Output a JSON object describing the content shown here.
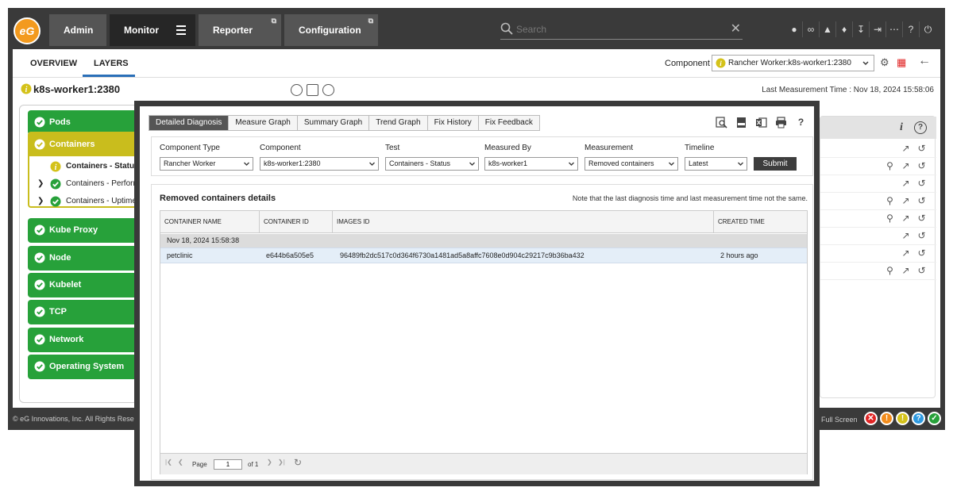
{
  "app": {
    "logo_text": "eG",
    "nav": {
      "admin": "Admin",
      "monitor": "Monitor",
      "reporter": "Reporter",
      "configuration": "Configuration",
      "external_glyph": "⧉"
    },
    "search": {
      "placeholder": "Search",
      "clear": "✕"
    },
    "toolbar_icons": [
      "user-icon",
      "link-icon",
      "alert-map-icon",
      "bell-icon",
      "download-icon",
      "login-icon",
      "more-icon",
      "help-icon",
      "power-icon"
    ]
  },
  "workspace": {
    "tabs": {
      "overview": "OVERVIEW",
      "layers": "LAYERS"
    },
    "component_label": "Component",
    "component_value": "Rancher Worker:k8s-worker1:2380",
    "page_title": "k8s-worker1:2380",
    "last_measurement": "Last Measurement Time : Nov 18, 2024 15:58:06",
    "layers": [
      {
        "label": "Pods",
        "status": "ok"
      },
      {
        "label": "Containers",
        "status": "warning"
      },
      {
        "label": "Kube Proxy",
        "status": "ok"
      },
      {
        "label": "Node",
        "status": "ok"
      },
      {
        "label": "Kubelet",
        "status": "ok"
      },
      {
        "label": "TCP",
        "status": "ok"
      },
      {
        "label": "Network",
        "status": "ok"
      },
      {
        "label": "Operating System",
        "status": "ok"
      }
    ],
    "container_tests": [
      {
        "label": "Containers - Status",
        "status": "warning"
      },
      {
        "label": "Containers - Performance",
        "status": "ok"
      },
      {
        "label": "Containers - Uptime",
        "status": "ok"
      }
    ],
    "right_header": {
      "info": "i",
      "help": "?"
    }
  },
  "footer": {
    "copyright": "© eG Innovations, Inc. All Rights Reserved",
    "fullscreen": "Full Screen",
    "status_dots": [
      {
        "glyph": "✕",
        "color": "#e02424"
      },
      {
        "glyph": "!",
        "color": "#f28c1c"
      },
      {
        "glyph": "!",
        "color": "#d4c21a"
      },
      {
        "glyph": "?",
        "color": "#2f9ae0"
      },
      {
        "glyph": "✓",
        "color": "#27a13a"
      }
    ]
  },
  "modal": {
    "tabs": [
      "Detailed Diagnosis",
      "Measure Graph",
      "Summary Graph",
      "Trend Graph",
      "Fix History",
      "Fix Feedback"
    ],
    "active_tab": "Detailed Diagnosis",
    "tool_icons": [
      "zoom-icon",
      "pdf-icon",
      "excel-icon",
      "print-icon",
      "help-icon"
    ],
    "help_glyph": "?",
    "filters": {
      "component_type": {
        "label": "Component Type",
        "value": "Rancher Worker"
      },
      "component": {
        "label": "Component",
        "value": "k8s-worker1:2380"
      },
      "test": {
        "label": "Test",
        "value": "Containers - Status"
      },
      "measured_by": {
        "label": "Measured By",
        "value": "k8s-worker1"
      },
      "measurement": {
        "label": "Measurement",
        "value": "Removed containers"
      },
      "timeline": {
        "label": "Timeline",
        "value": "Latest"
      }
    },
    "submit_label": "Submit",
    "results_title": "Removed containers details",
    "results_note": "Note that the last diagnosis time and last measurement time not the same.",
    "columns": [
      "CONTAINER NAME",
      "CONTAINER ID",
      "IMAGES ID",
      "CREATED TIME"
    ],
    "group_label": "Nov 18, 2024 15:58:38",
    "rows": [
      {
        "name": "petclinic",
        "id": "e644b6a505e5",
        "image": "96489fb2dc517c0d364f6730a1481ad5a8affc7608e0d904c29217c9b36ba432",
        "created": "2 hours ago"
      }
    ],
    "pager": {
      "page_label": "Page",
      "page_value": "1",
      "of_label": "of 1"
    }
  },
  "colors": {
    "ok": "#27a13a",
    "warning": "#c9bd1d",
    "frame": "#3a3a3a",
    "accent": "#2a6fb8"
  }
}
